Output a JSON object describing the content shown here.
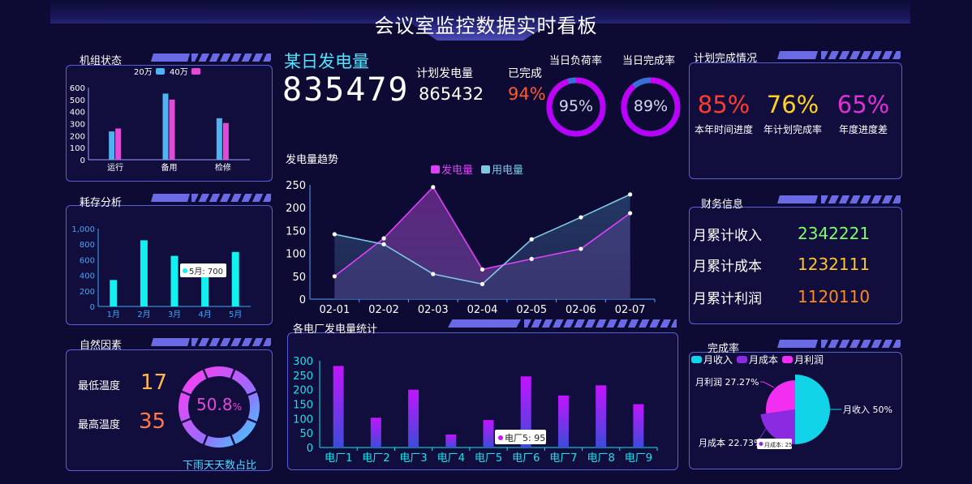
{
  "title": "会议室监控数据实时看板",
  "unit_status": {
    "title": "机组状态",
    "chart_data": {
      "type": "bar",
      "categories": [
        "运行",
        "备用",
        "检修"
      ],
      "series": [
        {
          "name": "20万",
          "values": [
            235,
            550,
            345
          ],
          "color": "#4fb3f0"
        },
        {
          "name": "40万",
          "values": [
            260,
            500,
            305
          ],
          "color": "#e44ad8"
        }
      ],
      "ylim": [
        0,
        600
      ],
      "yticks": [
        "0",
        "100",
        "200",
        "300",
        "400",
        "500",
        "600"
      ]
    }
  },
  "consumption": {
    "title": "耗存分析",
    "tooltip": "5月: 700",
    "chart_data": {
      "type": "bar",
      "categories": [
        "1月",
        "2月",
        "3月",
        "4月",
        "5月"
      ],
      "values": [
        340,
        850,
        650,
        450,
        700
      ],
      "ylim": [
        0,
        1000
      ],
      "yticks": [
        "0",
        "200",
        "400",
        "600",
        "800",
        "1,000"
      ]
    }
  },
  "nature": {
    "title": "自然因素",
    "min_label": "最低温度",
    "min_value": "17",
    "max_label": "最高温度",
    "max_value": "35",
    "ring_value": "50.8",
    "ring_unit": "%",
    "ring_fraction": 0.508,
    "caption": "下雨天天数占比"
  },
  "daily": {
    "title": "某日发电量",
    "value": "835479",
    "plan_label": "计划发电量",
    "plan_value": "865432",
    "done_label": "已完成",
    "done_value": "94%",
    "load_label": "当日负荷率",
    "load_value": "95%",
    "load_fraction": 0.95,
    "rate_label": "当日完成率",
    "rate_value": "89%",
    "rate_fraction": 0.89
  },
  "trend": {
    "title": "发电量趋势",
    "chart_data": {
      "type": "area",
      "categories": [
        "02-01",
        "02-02",
        "02-03",
        "02-04",
        "02-05",
        "02-06",
        "02-07"
      ],
      "series": [
        {
          "name": "发电量",
          "values": [
            50,
            133,
            245,
            65,
            88,
            110,
            188
          ],
          "color": "#e040fb"
        },
        {
          "name": "用电量",
          "values": [
            142,
            120,
            55,
            33,
            131,
            179,
            229
          ],
          "color": "#7ec8e3"
        }
      ],
      "ylim": [
        0,
        250
      ],
      "yticks": [
        "0",
        "50",
        "100",
        "150",
        "200",
        "250"
      ]
    }
  },
  "plants": {
    "title": "各电厂发电量统计",
    "tooltip": "电厂5: 95",
    "chart_data": {
      "type": "bar",
      "categories": [
        "电厂1",
        "电厂2",
        "电厂3",
        "电厂4",
        "电厂5",
        "电厂6",
        "电厂7",
        "电厂8",
        "电厂9"
      ],
      "values": [
        282,
        103,
        200,
        45,
        95,
        246,
        180,
        215,
        150
      ],
      "ylim": [
        0,
        300
      ],
      "yticks": [
        "0",
        "50",
        "100",
        "150",
        "200",
        "250",
        "300"
      ]
    }
  },
  "plan": {
    "title": "计划完成情况",
    "items": [
      {
        "value": "85%",
        "label": "本年时间进度",
        "color": "#ff3b30"
      },
      {
        "value": "76%",
        "label": "年计划完成率",
        "color": "#ffd21f"
      },
      {
        "value": "65%",
        "label": "年度进度差",
        "color": "#e42ed8"
      }
    ]
  },
  "finance": {
    "title": "财务信息",
    "rows": [
      {
        "label": "月累计收入",
        "value": "2342221",
        "color": "#7dff6a"
      },
      {
        "label": "月累计成本",
        "value": "1232111",
        "color": "#ffc42e"
      },
      {
        "label": "月累计利润",
        "value": "1120110",
        "color": "#ff8a1f"
      }
    ]
  },
  "completion": {
    "title": "完成率",
    "tooltip": "月成本: 25",
    "chart_data": {
      "type": "pie",
      "slices": [
        {
          "name": "月收入",
          "value": 50,
          "label": "月收入 50%",
          "color": "#12d4e8"
        },
        {
          "name": "月成本",
          "value": 22.73,
          "label": "月成本 22.73%",
          "color": "#8a2be2"
        },
        {
          "name": "月利润",
          "value": 27.27,
          "label": "月利润 27.27%",
          "color": "#f22ef0"
        }
      ]
    }
  }
}
